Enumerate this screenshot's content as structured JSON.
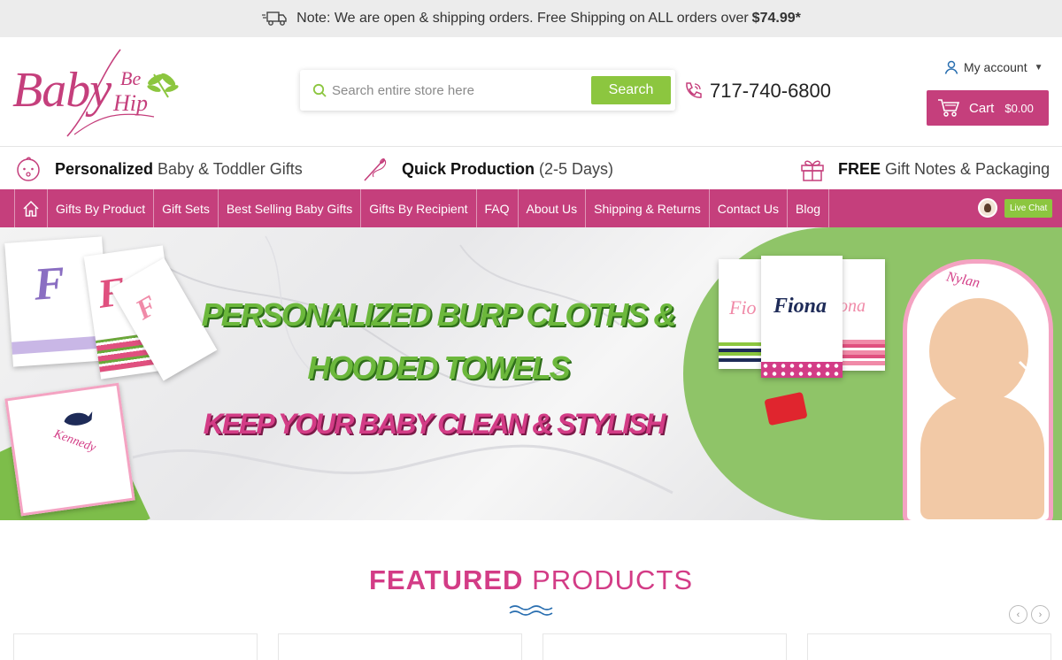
{
  "notice": {
    "text": "Note: We are open & shipping orders. Free Shipping on ALL orders over",
    "amount": "$74.99*",
    "icon": "truck-icon"
  },
  "logo": {
    "line1": "Baby",
    "line2": "Be",
    "line3": "Hip"
  },
  "search": {
    "placeholder": "Search entire store here",
    "button": "Search"
  },
  "phone": "717-740-6800",
  "account": {
    "label": "My account"
  },
  "cart": {
    "label": "Cart",
    "total": "$0.00"
  },
  "benefits": [
    {
      "bold": "Personalized",
      "text": "Baby & Toddler Gifts",
      "icon": "baby-face-icon"
    },
    {
      "bold": "Quick Production",
      "text": "(2-5 Days)",
      "icon": "needle-icon"
    },
    {
      "bold": "FREE",
      "text": "Gift Notes & Packaging",
      "icon": "gift-icon"
    }
  ],
  "nav": {
    "items": [
      "Gifts By Product",
      "Gift Sets",
      "Best Selling Baby Gifts",
      "Gifts By Recipient",
      "FAQ",
      "About Us",
      "Shipping & Returns",
      "Contact Us",
      "Blog"
    ],
    "live_chat": "Live Chat"
  },
  "banner": {
    "line1": "PERSONALIZED BURP CLOTHS &",
    "line2": "HOODED TOWELS",
    "line3": "KEEP YOUR BABY CLEAN & STYLISH",
    "towel_names": [
      "Kennedy",
      "Fio",
      "Fiona",
      "ona",
      "Nylan"
    ],
    "monograms": [
      "F",
      "F",
      "F"
    ]
  },
  "featured": {
    "bold": "FEATURED",
    "light": "PRODUCTS"
  },
  "colors": {
    "brand_pink": "#c53f7c",
    "accent_green": "#8cc63f"
  }
}
